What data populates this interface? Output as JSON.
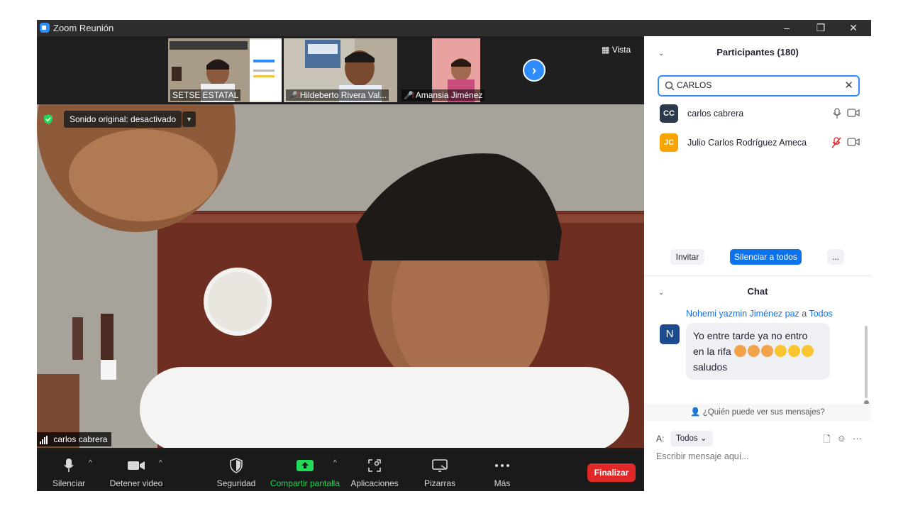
{
  "window": {
    "title": "Zoom Reunión",
    "minimize": "–",
    "restore": "❐",
    "close": "✕"
  },
  "gallery": {
    "tiles": [
      {
        "name": "SETSE ESTATAL",
        "muted": false
      },
      {
        "name": "Hildeberto Rivera Val...",
        "muted": true
      },
      {
        "name": "Amansia Jiménez",
        "muted": true
      }
    ],
    "next": "›",
    "view_label": "Vista"
  },
  "main_video": {
    "sound_label": "Sonido original: desactivado",
    "sound_dropdown": "▼",
    "speaker_name": "carlos cabrera"
  },
  "toolbar": {
    "mute": "Silenciar",
    "stop_video": "Detener video",
    "security": "Seguridad",
    "share": "Compartir pantalla",
    "apps": "Aplicaciones",
    "whiteboards": "Pizarras",
    "more": "Más",
    "end": "Finalizar",
    "caret": "^",
    "colors": {
      "share_green": "#23d959",
      "end_red": "#e02828"
    }
  },
  "participants": {
    "header": "Participantes (180)",
    "search_value": "CARLOS",
    "clear": "✕",
    "list": [
      {
        "initials": "CC",
        "name": "carlos cabrera",
        "avatar_color": "#2b3a4a",
        "muted": false
      },
      {
        "initials": "JC",
        "name": "Julio Carlos Rodríguez Ameca",
        "avatar_color": "#f7a400",
        "muted": true
      }
    ],
    "invite": "Invitar",
    "mute_all": "Silenciar a todos",
    "more": "..."
  },
  "chat": {
    "header": "Chat",
    "collapse": "⌄",
    "message": {
      "avatar": "N",
      "sender": "Nohemi yazmin Jiménez paz",
      "to_word": "a",
      "recipient": "Todos",
      "line1": "Yo entre tarde ya no entro",
      "line2": "en la rifa",
      "line3": "saludos"
    },
    "who_can_see": "¿Quién puede ver sus mensajes?",
    "to_label": "A:",
    "to_value": "Todos",
    "more": "···",
    "placeholder": "Escribir mensaje aquí..."
  },
  "accent": "#2d8cff"
}
